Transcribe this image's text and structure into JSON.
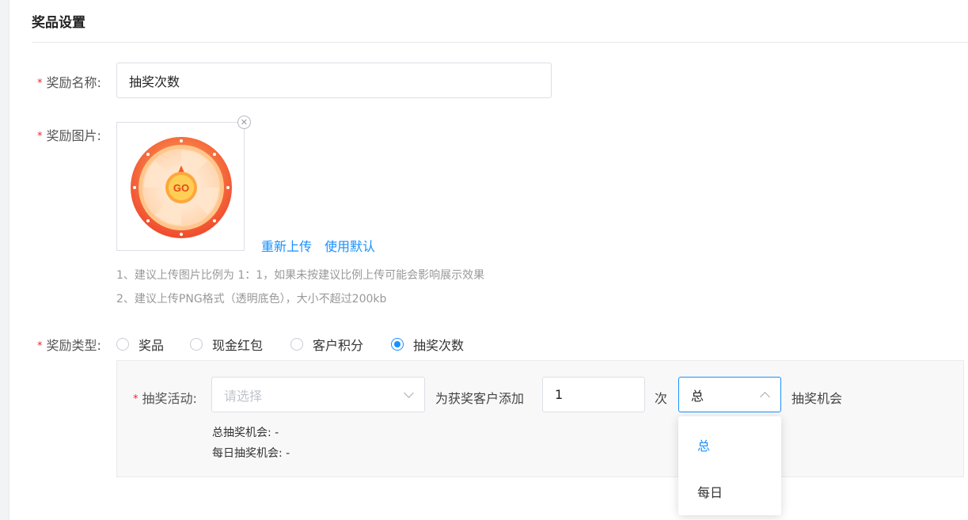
{
  "section": {
    "title": "奖品设置"
  },
  "form": {
    "required_mark": "*",
    "name_label": "奖励名称:",
    "name_value": "抽奖次数",
    "image_label": "奖励图片:",
    "image_go_text": "GO",
    "reupload_link": "重新上传",
    "use_default_link": "使用默认",
    "tips": [
      "1、建议上传图片比例为 1：1，如果未按建议比例上传可能会影响展示效果",
      "2、建议上传PNG格式（透明底色），大小不超过200kb"
    ],
    "type_label": "奖励类型:",
    "type_options": [
      "奖品",
      "现金红包",
      "客户积分",
      "抽奖次数"
    ],
    "type_selected": "抽奖次数"
  },
  "panel": {
    "activity_label": "抽奖活动:",
    "activity_placeholder": "请选择",
    "add_prefix": "为获奖客户添加",
    "count_value": "1",
    "count_unit": "次",
    "period_value": "总",
    "suffix": "抽奖机会",
    "total_chance": "总抽奖机会: -",
    "daily_chance": "每日抽奖机会: -"
  },
  "dropdown": {
    "options": [
      "总",
      "每日"
    ],
    "selected": "总"
  },
  "colors": {
    "accent": "#1890ff",
    "required": "#f5222d",
    "tip": "#999999"
  }
}
